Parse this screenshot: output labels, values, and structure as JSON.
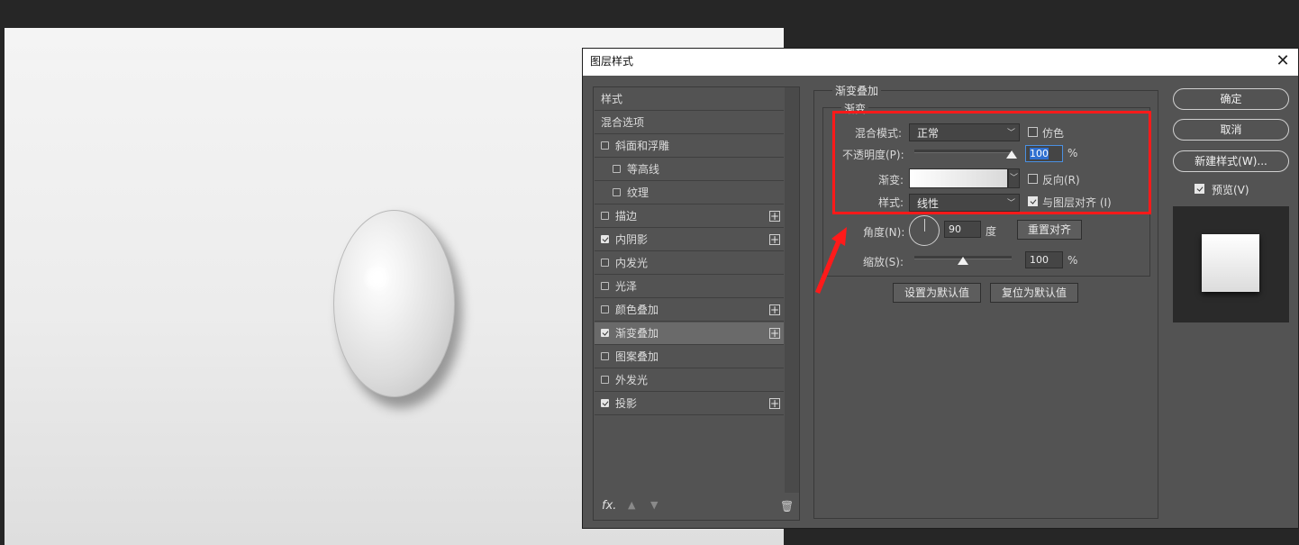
{
  "dialog": {
    "title": "图层样式",
    "close_icon": "✕"
  },
  "style_list": {
    "items": [
      {
        "label": "样式",
        "has_checkbox": false,
        "checked": false,
        "has_plus": false,
        "selected": false,
        "indent": false
      },
      {
        "label": "混合选项",
        "has_checkbox": false,
        "checked": false,
        "has_plus": false,
        "selected": false,
        "indent": false
      },
      {
        "label": "斜面和浮雕",
        "has_checkbox": true,
        "checked": false,
        "has_plus": false,
        "selected": false,
        "indent": false
      },
      {
        "label": "等高线",
        "has_checkbox": true,
        "checked": false,
        "has_plus": false,
        "selected": false,
        "indent": true
      },
      {
        "label": "纹理",
        "has_checkbox": true,
        "checked": false,
        "has_plus": false,
        "selected": false,
        "indent": true
      },
      {
        "label": "描边",
        "has_checkbox": true,
        "checked": false,
        "has_plus": true,
        "selected": false,
        "indent": false
      },
      {
        "label": "内阴影",
        "has_checkbox": true,
        "checked": true,
        "has_plus": true,
        "selected": false,
        "indent": false
      },
      {
        "label": "内发光",
        "has_checkbox": true,
        "checked": false,
        "has_plus": false,
        "selected": false,
        "indent": false
      },
      {
        "label": "光泽",
        "has_checkbox": true,
        "checked": false,
        "has_plus": false,
        "selected": false,
        "indent": false
      },
      {
        "label": "颜色叠加",
        "has_checkbox": true,
        "checked": false,
        "has_plus": true,
        "selected": false,
        "indent": false
      },
      {
        "label": "渐变叠加",
        "has_checkbox": true,
        "checked": true,
        "has_plus": true,
        "selected": true,
        "indent": false
      },
      {
        "label": "图案叠加",
        "has_checkbox": true,
        "checked": false,
        "has_plus": false,
        "selected": false,
        "indent": false
      },
      {
        "label": "外发光",
        "has_checkbox": true,
        "checked": false,
        "has_plus": false,
        "selected": false,
        "indent": false
      },
      {
        "label": "投影",
        "has_checkbox": true,
        "checked": true,
        "has_plus": true,
        "selected": false,
        "indent": false
      }
    ],
    "footer": {
      "fx_label": "fx.",
      "up_icon": "▲",
      "down_icon": "▼",
      "trash_icon": "🗑"
    }
  },
  "gradient_overlay": {
    "section_title": "渐变叠加",
    "group_title": "渐变",
    "blend_mode_label": "混合模式:",
    "blend_mode_value": "正常",
    "dither_label": "仿色",
    "dither_checked": false,
    "opacity_label": "不透明度(P):",
    "opacity_value": "100",
    "opacity_unit": "%",
    "opacity_level": 1.0,
    "gradient_label": "渐变:",
    "reverse_label": "反向(R)",
    "reverse_checked": false,
    "style_label": "样式:",
    "style_value": "线性",
    "align_label": "与图层对齐 (I)",
    "align_checked": true,
    "angle_label": "角度(N):",
    "angle_value": "90",
    "angle_unit": "度",
    "reset_align_label": "重置对齐",
    "scale_label": "缩放(S):",
    "scale_value": "100",
    "scale_unit": "%",
    "scale_level": 0.5,
    "set_default_label": "设置为默认值",
    "reset_default_label": "复位为默认值"
  },
  "right_panel": {
    "ok_label": "确定",
    "cancel_label": "取消",
    "new_style_label": "新建样式(W)...",
    "preview_label": "预览(V)",
    "preview_checked": true
  },
  "colors": {
    "annotation_red": "#ff1a1a",
    "dialog_bg": "#535353",
    "selection_bg": "#6a6a6a"
  }
}
